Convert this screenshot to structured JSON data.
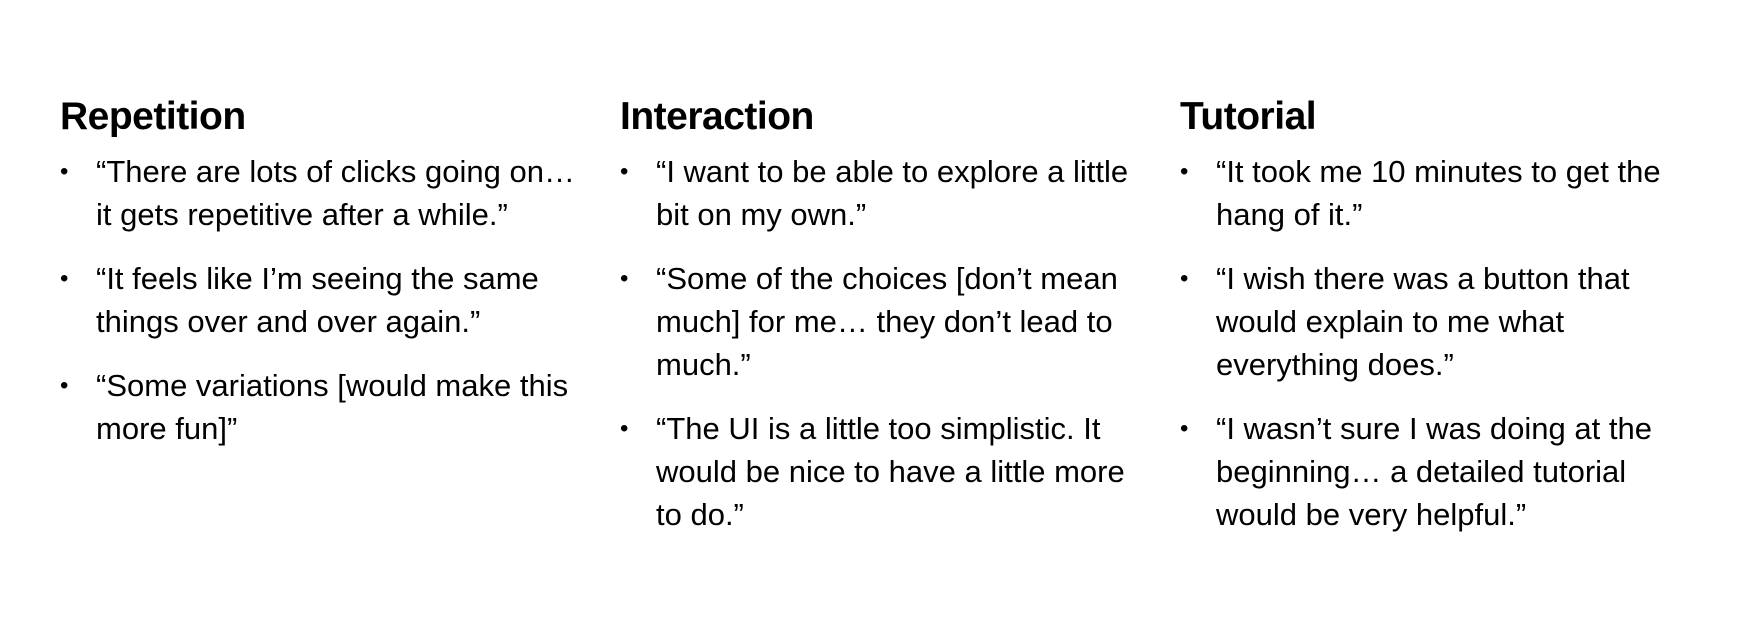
{
  "columns": [
    {
      "heading": "Repetition",
      "quotes": [
        "“There are lots of clicks going on… it gets repetitive after a while.”",
        "“It feels like I’m seeing the same things over and over again.”",
        "“Some variations [would make this more fun]”"
      ]
    },
    {
      "heading": "Interaction",
      "quotes": [
        "“I want to be able to explore a little bit on my own.”",
        "“Some of the choices [don’t mean much] for me… they don’t lead to much.”",
        "“The UI is a little too simplistic. It would be nice to have a little more to do.”"
      ]
    },
    {
      "heading": "Tutorial",
      "quotes": [
        "“It took me 10 minutes to get the hang of it.”",
        "“I wish there was a button that would explain to me what everything does.”",
        "“I wasn’t sure I was doing at the beginning… a detailed tutorial would be very helpful.”"
      ]
    }
  ]
}
